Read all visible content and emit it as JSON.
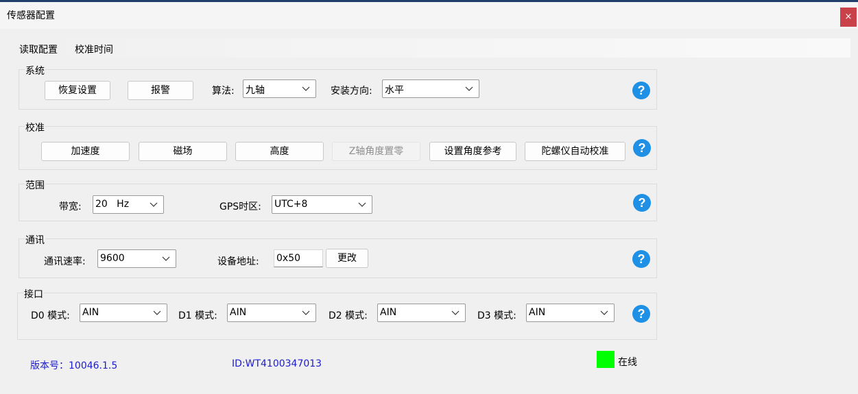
{
  "window": {
    "title": "传感器配置",
    "close_label": "×"
  },
  "menu": {
    "items": [
      "读取配置",
      "校准时间"
    ]
  },
  "system": {
    "legend": "系统",
    "restore_button": "恢复设置",
    "alarm_button": "报警",
    "algorithm_label": "算法:",
    "algorithm_value": "九轴",
    "orientation_label": "安装方向:",
    "orientation_value": "水平"
  },
  "calibration": {
    "legend": "校准",
    "buttons": [
      "加速度",
      "磁场",
      "高度",
      "Z轴角度置零",
      "设置角度参考",
      "陀螺仪自动校准"
    ]
  },
  "range": {
    "legend": "范围",
    "bandwidth_label": "带宽:",
    "bandwidth_value": "20   Hz",
    "gps_tz_label": "GPS时区:",
    "gps_tz_value": "UTC+8"
  },
  "comm": {
    "legend": "通讯",
    "baud_label": "通讯速率:",
    "baud_value": "9600",
    "address_label": "设备地址:",
    "address_value": "0x50",
    "change_button": "更改"
  },
  "interface": {
    "legend": "接口",
    "d0_label": "D0 模式:",
    "d0_value": "AIN",
    "d1_label": "D1 模式:",
    "d1_value": "AIN",
    "d2_label": "D2 模式:",
    "d2_value": "AIN",
    "d3_label": "D3 模式:",
    "d3_value": "AIN"
  },
  "footer": {
    "version": "版本号：10046.1.5",
    "device_id": "ID:WT4100347013",
    "status": "在线",
    "status_color": "#00ff00",
    "link_color": "#1c1ccd"
  },
  "colors": {
    "help_blue": "#1e90e6",
    "close_red": "#c94249"
  }
}
